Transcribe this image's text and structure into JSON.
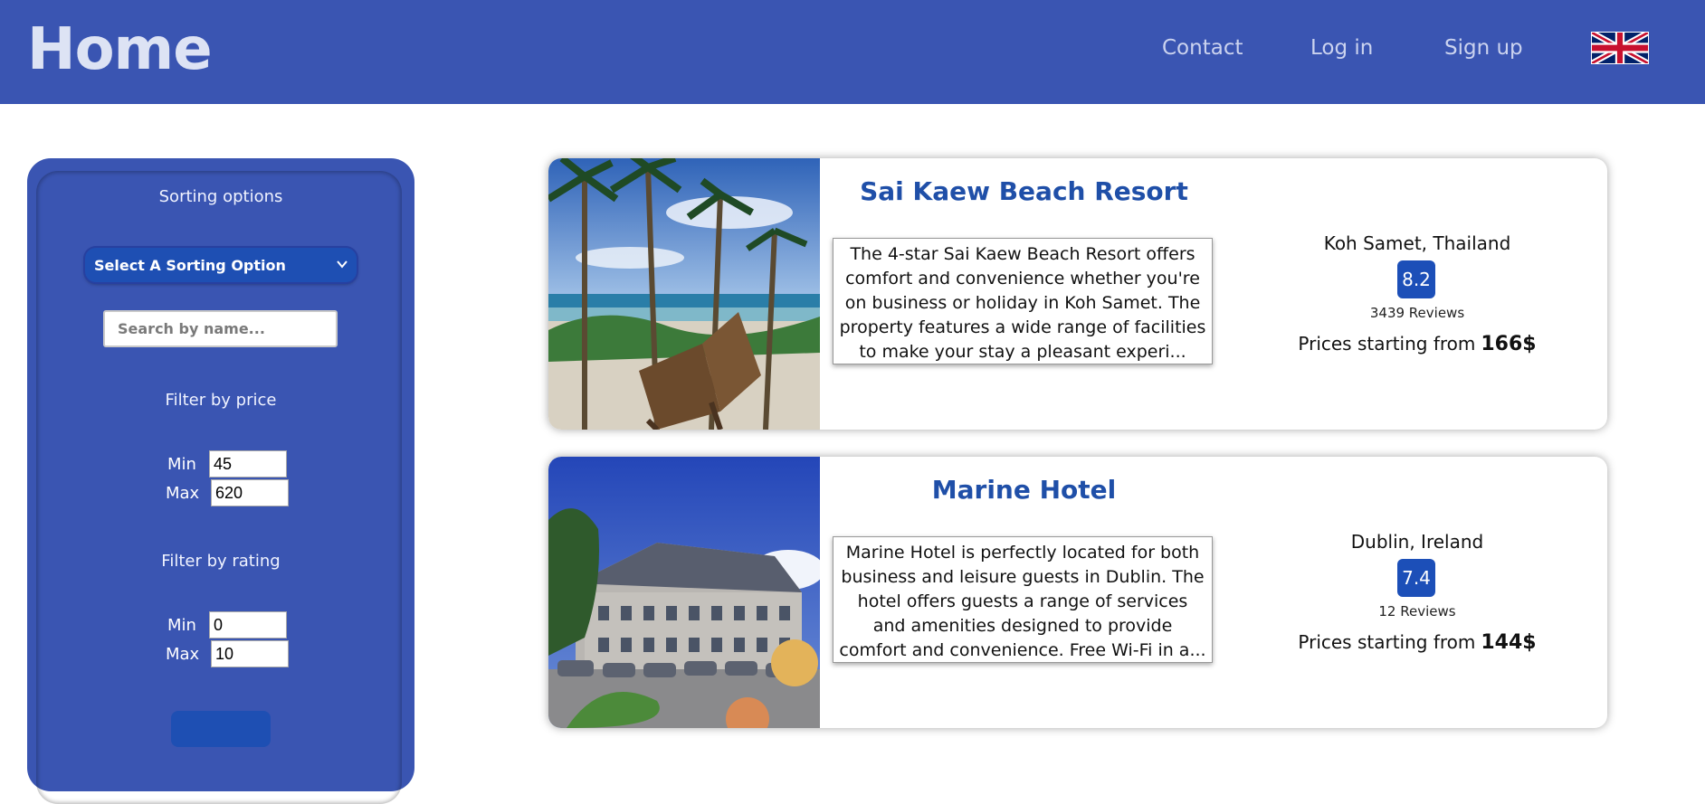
{
  "header": {
    "title": "Home",
    "nav": {
      "contact": "Contact",
      "login": "Log in",
      "signup": "Sign up"
    },
    "language_icon": "uk-flag-icon",
    "bg_color": "#3a55b2"
  },
  "sidebar": {
    "sorting_label": "Sorting options",
    "sort_select_value": "Select A Sorting Option",
    "search_placeholder": "Search by name...",
    "price_label": "Filter by price",
    "price_min_label": "Min",
    "price_max_label": "Max",
    "price_min": "45",
    "price_max": "620",
    "rating_label": "Filter by rating",
    "rating_min_label": "Min",
    "rating_max_label": "Max",
    "rating_min": "0",
    "rating_max": "10"
  },
  "hotels": [
    {
      "name": "Sai Kaew Beach Resort",
      "description": "The 4-star Sai Kaew Beach Resort offers comfort and convenience whether you're on business or holiday in Koh Samet. The property features a wide range of facilities to make your stay a pleasant experi...",
      "location": "Koh Samet, Thailand",
      "rating": "8.2",
      "reviews": "3439 Reviews",
      "price_prefix": "Prices starting from",
      "price": "166$"
    },
    {
      "name": "Marine Hotel",
      "description": "Marine Hotel is perfectly located for both business and leisure guests in Dublin. The hotel offers guests a range of services and amenities designed to provide comfort and convenience. Free Wi-Fi in a...",
      "location": "Dublin, Ireland",
      "rating": "7.4",
      "reviews": "12 Reviews",
      "price_prefix": "Prices starting from",
      "price": "144$"
    }
  ]
}
